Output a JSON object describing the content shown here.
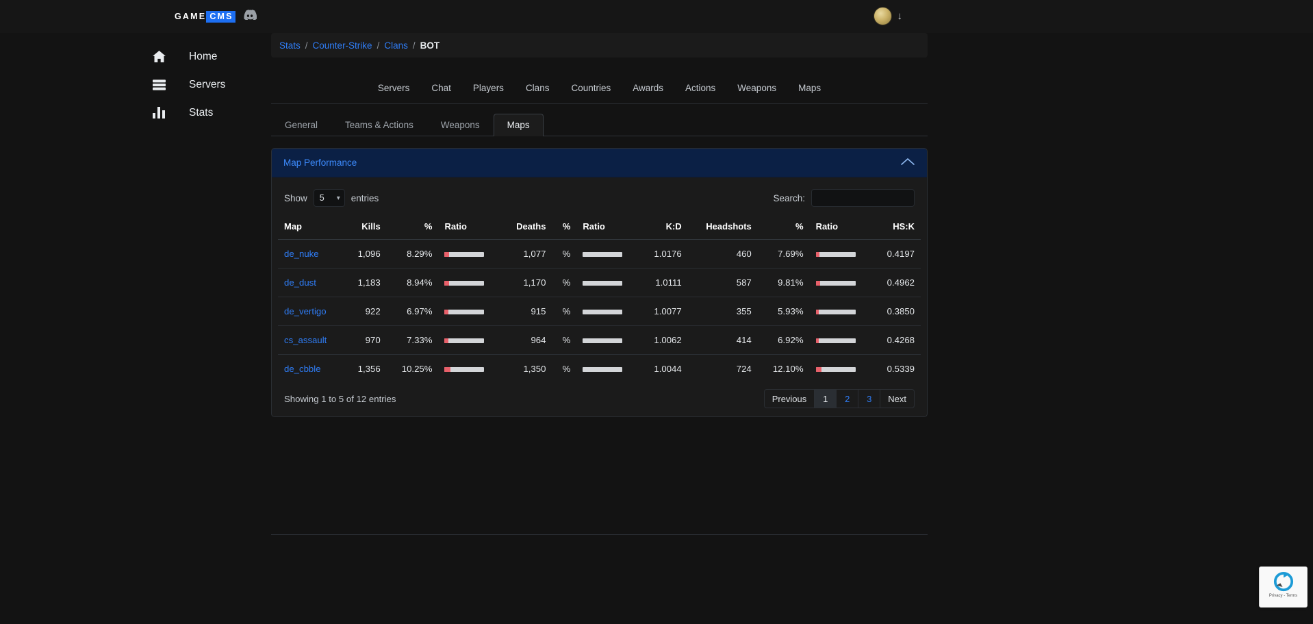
{
  "brand": {
    "name_light": "GAME",
    "name_accent": "CMS",
    "discord_icon": "discord-icon",
    "accent_color": "#1d6ff2"
  },
  "topbar": {
    "avatar_icon": "avatar",
    "caret_icon": "chevron-down-icon"
  },
  "sidebar": {
    "items": [
      {
        "label": "Home",
        "icon": "home-icon"
      },
      {
        "label": "Servers",
        "icon": "server-icon"
      },
      {
        "label": "Stats",
        "icon": "chart-bar-icon"
      }
    ]
  },
  "breadcrumb": {
    "links": [
      "Stats",
      "Counter-Strike",
      "Clans"
    ],
    "separator": "/",
    "current": "BOT"
  },
  "navbar": {
    "items": [
      "Servers",
      "Chat",
      "Players",
      "Clans",
      "Countries",
      "Awards",
      "Actions",
      "Weapons",
      "Maps"
    ]
  },
  "tabs": {
    "items": [
      "General",
      "Teams & Actions",
      "Weapons",
      "Maps"
    ],
    "active": "Maps"
  },
  "card": {
    "title": "Map Performance",
    "collapse_icon": "chevron-up-icon"
  },
  "datatable": {
    "show_label": "Show",
    "entries_label": "entries",
    "page_length": "5",
    "length_caret": "chevron-down-icon",
    "search_label": "Search:",
    "search_value": "",
    "search_placeholder": "",
    "info": "Showing 1 to 5 of 12 entries",
    "columns": [
      "Map",
      "Kills",
      "%",
      "Ratio",
      "Deaths",
      "%",
      "Ratio",
      "K:D",
      "Headshots",
      "%",
      "Ratio",
      "HS:K"
    ],
    "sorted_column": "K:D",
    "sort_icon": "sort-descending-icon",
    "rows": [
      {
        "map": "de_nuke",
        "kills": "1,096",
        "kills_pct": "8.29%",
        "kills_bar": 12,
        "deaths": "1,077",
        "deaths_pct": "%",
        "deaths_bar": 0,
        "kd": "1.0176",
        "headshots": "460",
        "hs_pct": "7.69%",
        "hs_bar": 9,
        "hsk": "0.4197"
      },
      {
        "map": "de_dust",
        "kills": "1,183",
        "kills_pct": "8.94%",
        "kills_bar": 12,
        "deaths": "1,170",
        "deaths_pct": "%",
        "deaths_bar": 0,
        "kd": "1.0111",
        "headshots": "587",
        "hs_pct": "9.81%",
        "hs_bar": 11,
        "hsk": "0.4962"
      },
      {
        "map": "de_vertigo",
        "kills": "922",
        "kills_pct": "6.97%",
        "kills_bar": 9,
        "deaths": "915",
        "deaths_pct": "%",
        "deaths_bar": 0,
        "kd": "1.0077",
        "headshots": "355",
        "hs_pct": "5.93%",
        "hs_bar": 7,
        "hsk": "0.3850"
      },
      {
        "map": "cs_assault",
        "kills": "970",
        "kills_pct": "7.33%",
        "kills_bar": 10,
        "deaths": "964",
        "deaths_pct": "%",
        "deaths_bar": 0,
        "kd": "1.0062",
        "headshots": "414",
        "hs_pct": "6.92%",
        "hs_bar": 8,
        "hsk": "0.4268"
      },
      {
        "map": "de_cbble",
        "kills": "1,356",
        "kills_pct": "10.25%",
        "kills_bar": 14,
        "deaths": "1,350",
        "deaths_pct": "%",
        "deaths_bar": 0,
        "kd": "1.0044",
        "headshots": "724",
        "hs_pct": "12.10%",
        "hs_bar": 15,
        "hsk": "0.5339"
      }
    ],
    "pagination": {
      "previous": "Previous",
      "pages": [
        "1",
        "2",
        "3"
      ],
      "active_page": "1",
      "next": "Next"
    }
  },
  "recaptcha": {
    "line1": "Privacy",
    "sep": "-",
    "line2": "Terms",
    "icon": "recaptcha-icon"
  }
}
